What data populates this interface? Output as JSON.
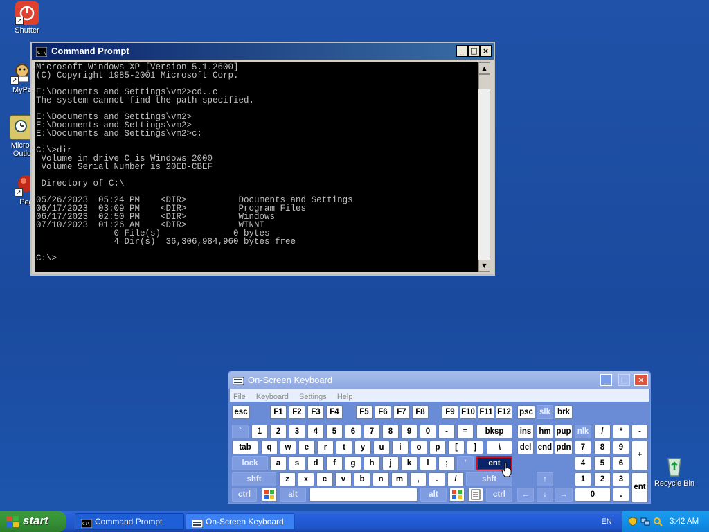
{
  "desktop": {
    "icons": [
      {
        "label": "Shutter",
        "icon": "shutdown-icon"
      },
      {
        "label": "MyPa",
        "icon": "my-pages-icon"
      },
      {
        "label": "Micros Outlo",
        "icon": "outlook-icon"
      },
      {
        "label": "Peg",
        "icon": "pegasus-icon"
      },
      {
        "label": "Recycle Bin",
        "icon": "recycle-bin-icon"
      }
    ]
  },
  "cmd": {
    "title": "Command Prompt",
    "minimize": "_",
    "maximize": "□",
    "close": "×",
    "lines": [
      "Microsoft Windows XP [Version 5.1.2600]",
      "(C) Copyright 1985-2001 Microsoft Corp.",
      "",
      "E:\\Documents and Settings\\vm2>cd..c",
      "The system cannot find the path specified.",
      "",
      "E:\\Documents and Settings\\vm2>",
      "E:\\Documents and Settings\\vm2>",
      "E:\\Documents and Settings\\vm2>c:",
      "",
      "C:\\>dir",
      " Volume in drive C is Windows 2000",
      " Volume Serial Number is 20ED-CBEF",
      "",
      " Directory of C:\\",
      "",
      "05/26/2023  05:24 PM    <DIR>          Documents and Settings",
      "06/17/2023  03:09 PM    <DIR>          Program Files",
      "06/17/2023  02:50 PM    <DIR>          Windows",
      "07/10/2023  01:26 AM    <DIR>          WINNT",
      "               0 File(s)              0 bytes",
      "               4 Dir(s)  36,306,984,960 bytes free",
      "",
      "C:\\>"
    ]
  },
  "osk": {
    "title": "On-Screen Keyboard",
    "menu": [
      "File",
      "Keyboard",
      "Settings",
      "Help"
    ],
    "keys": {
      "esc": "esc",
      "f1": "F1",
      "f2": "F2",
      "f3": "F3",
      "f4": "F4",
      "f5": "F5",
      "f6": "F6",
      "f7": "F7",
      "f8": "F8",
      "f9": "F9",
      "f10": "F10",
      "f11": "F11",
      "f12": "F12",
      "psc": "psc",
      "slk": "slk",
      "brk": "brk",
      "grave": "`",
      "k1": "1",
      "k2": "2",
      "k3": "3",
      "k4": "4",
      "k5": "5",
      "k6": "6",
      "k7": "7",
      "k8": "8",
      "k9": "9",
      "k0": "0",
      "minus": "-",
      "equals": "=",
      "bksp": "bksp",
      "ins": "ins",
      "hm": "hm",
      "pup": "pup",
      "nlk": "nlk",
      "slash_np": "/",
      "star_np": "*",
      "minus_np": "-",
      "tab": "tab",
      "q": "q",
      "w": "w",
      "e": "e",
      "r": "r",
      "t": "t",
      "y": "y",
      "u": "u",
      "i": "i",
      "o": "o",
      "p": "p",
      "lbr": "[",
      "rbr": "]",
      "bslash": "\\",
      "del": "del",
      "end": "end",
      "pdn": "pdn",
      "n7": "7",
      "n8": "8",
      "n9": "9",
      "plus_np": "+",
      "lock": "lock",
      "a": "a",
      "s": "s",
      "d": "d",
      "f": "f",
      "g": "g",
      "h": "h",
      "j": "j",
      "k": "k",
      "l": "l",
      "semi": ";",
      "quote": "'",
      "ent": "ent",
      "n4": "4",
      "n5": "5",
      "n6": "6",
      "shft_l": "shft",
      "z": "z",
      "x": "x",
      "c": "c",
      "v": "v",
      "b": "b",
      "n": "n",
      "m": "m",
      "comma": ",",
      "period": ".",
      "slash": "/",
      "shft_r": "shft",
      "up": "↑",
      "n1": "1",
      "n2": "2",
      "n3": "3",
      "ent_np": "ent",
      "ctrl_l": "ctrl",
      "alt_l": "alt",
      "space": "",
      "alt_r": "alt",
      "ctrl_r": "ctrl",
      "left": "←",
      "down": "↓",
      "right": "→",
      "n0": "0",
      "dot_np": "."
    }
  },
  "taskbar": {
    "start": "start",
    "tasks": [
      "Command Prompt",
      "On-Screen Keyboard"
    ],
    "lang": "EN",
    "clock": "3:42 AM"
  },
  "colors": {
    "desktop": "#1d4fa3",
    "selected_key": "#0a246a",
    "key_highlight_border": "#d01020"
  }
}
